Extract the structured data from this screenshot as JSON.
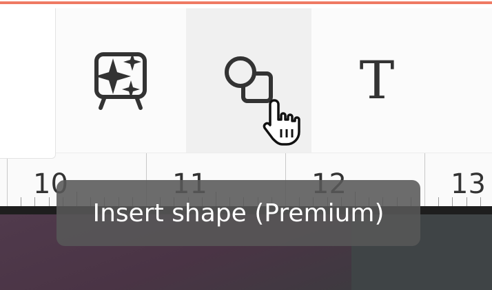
{
  "toolbar": {
    "tools": [
      {
        "id": "magic",
        "icon": "magic-media-icon"
      },
      {
        "id": "shape",
        "icon": "shapes-icon"
      },
      {
        "id": "text",
        "icon": "text-icon",
        "glyph": "T"
      }
    ],
    "hovered": "shape"
  },
  "ruler": {
    "labels": [
      "10",
      "11",
      "12",
      "13"
    ]
  },
  "tooltip": {
    "text": "Insert shape (Premium)"
  },
  "colors": {
    "accent": "#ef7a63",
    "tooltip_bg": "#585858",
    "icon": "#333333"
  },
  "cursor": {
    "icon": "hand-pointer-icon"
  }
}
